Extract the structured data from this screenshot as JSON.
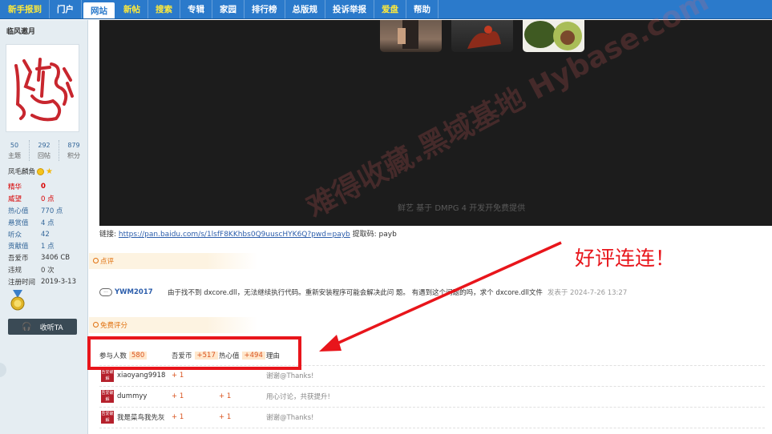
{
  "nav": {
    "items": [
      {
        "label": "新手报到",
        "style": "yellow"
      },
      {
        "label": "门户",
        "style": "normal"
      },
      {
        "label": "网站",
        "style": "active"
      },
      {
        "label": "新帖",
        "style": "yellow"
      },
      {
        "label": "搜索",
        "style": "yellow"
      },
      {
        "label": "专辑",
        "style": "normal"
      },
      {
        "label": "家园",
        "style": "normal"
      },
      {
        "label": "排行榜",
        "style": "normal"
      },
      {
        "label": "总版规",
        "style": "normal"
      },
      {
        "label": "投诉举报",
        "style": "normal"
      },
      {
        "label": "爱盘",
        "style": "yellow"
      },
      {
        "label": "帮助",
        "style": "normal"
      }
    ]
  },
  "sidebar": {
    "username": "临风邀月",
    "stats": [
      {
        "num": "50",
        "label": "主题"
      },
      {
        "num": "292",
        "label": "回帖"
      },
      {
        "num": "879",
        "label": "积分"
      }
    ],
    "rank": "凤毛麟角",
    "props": [
      {
        "key": "精华",
        "value": "0",
        "style": "red"
      },
      {
        "key": "威望",
        "value": "0 点",
        "style": "red-light"
      },
      {
        "key": "热心值",
        "value": "770 点",
        "style": "blue"
      },
      {
        "key": "悬赏值",
        "value": "4 点",
        "style": "blue"
      },
      {
        "key": "听众",
        "value": "42",
        "style": "blue"
      },
      {
        "key": "贡献值",
        "value": "1 点",
        "style": "blue"
      },
      {
        "key": "吾爱币",
        "value": "3406 CB",
        "style": "dark"
      },
      {
        "key": "违规",
        "value": "0 次",
        "style": "gray"
      },
      {
        "key": "注册时间",
        "value": "2019-3-13",
        "style": "dark"
      }
    ],
    "listen_button": "收听TA"
  },
  "video": {
    "caption": "鲜艺  基于 DMPG  4 开发开免费提供"
  },
  "link": {
    "prefix": "链接: ",
    "url": "https://pan.baidu.com/s/1lsfF8KKhbs0Q9uuscHYK6Q?pwd=payb",
    "code_label": " 提取码: payb"
  },
  "review": {
    "title": "点评",
    "user": "YWM2017",
    "text": "由于找不到 dxcore.dll，无法继续执行代码。重新安装程序可能会解决此问 题。 有遇到这个问题的吗，求个 dxcore.dll文件",
    "time": "发表于 2024-7-26 13:27"
  },
  "rating": {
    "title": "免费评分",
    "header": {
      "participants_label": "参与人数",
      "participants": "580",
      "coin_label": "吾爱币",
      "coin": "+517",
      "heart_label": "热心值",
      "heart": "+494",
      "reason_label": "理由"
    },
    "rows": [
      {
        "name": "xiaoyang9918",
        "coin": "+ 1",
        "heart": "",
        "reason": "谢谢@Thanks!"
      },
      {
        "name": "dummyy",
        "coin": "+ 1",
        "heart": "+ 1",
        "reason": "用心讨论，共获提升!"
      },
      {
        "name": "我是菜鸟我先灰",
        "coin": "+ 1",
        "heart": "+ 1",
        "reason": "谢谢@Thanks!"
      }
    ],
    "avatar_text": "吾爱破解"
  },
  "annotation": {
    "text": "好评连连！"
  },
  "watermark": {
    "text": "难得收藏.黑域基地 Hybase.com"
  },
  "colors": {
    "nav_bg": "#2b7acb",
    "sidebar_bg": "#e5edf2",
    "annotation_red": "#e8151b",
    "link_blue": "#2b5dab"
  }
}
